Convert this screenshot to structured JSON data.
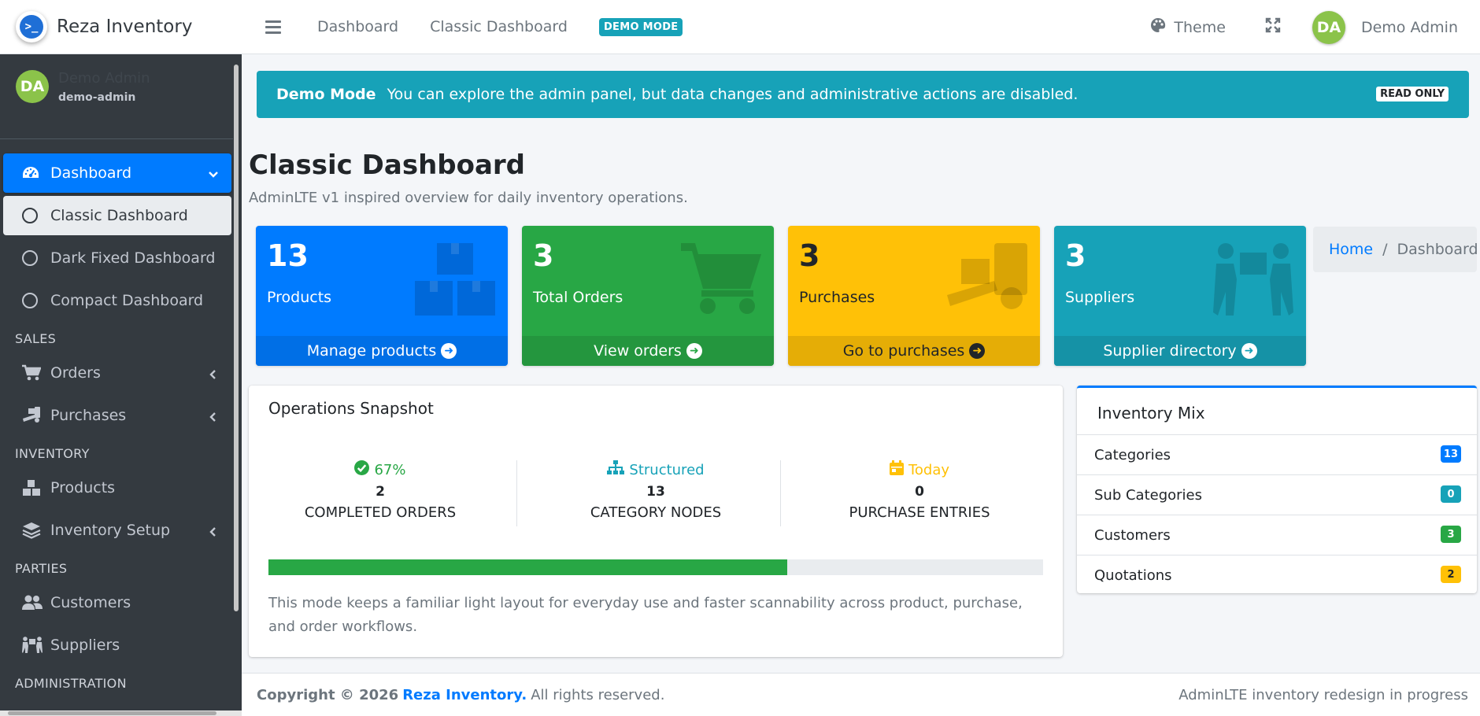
{
  "brand": {
    "name": "Reza Inventory",
    "logo_glyph": ">_"
  },
  "sidebar": {
    "user": {
      "initials": "DA",
      "name": "Demo Admin",
      "handle": "demo-admin"
    },
    "items": [
      {
        "label": "Dashboard"
      },
      {
        "label": "Classic Dashboard"
      },
      {
        "label": "Dark Fixed Dashboard"
      },
      {
        "label": "Compact Dashboard"
      }
    ],
    "sales_header": "SALES",
    "sales": [
      {
        "label": "Orders"
      },
      {
        "label": "Purchases"
      }
    ],
    "inventory_header": "INVENTORY",
    "inventory": [
      {
        "label": "Products"
      },
      {
        "label": "Inventory Setup"
      }
    ],
    "parties_header": "PARTIES",
    "parties": [
      {
        "label": "Customers"
      },
      {
        "label": "Suppliers"
      }
    ],
    "admin_header": "ADMINISTRATION"
  },
  "topbar": {
    "links": [
      "Dashboard",
      "Classic Dashboard"
    ],
    "badge": "DEMO MODE",
    "theme": "Theme",
    "user_initials": "DA",
    "user_name": "Demo Admin"
  },
  "alert": {
    "title": "Demo Mode",
    "message": "You can explore the admin panel, but data changes and administrative actions are disabled.",
    "badge": "READ ONLY"
  },
  "page": {
    "title": "Classic Dashboard",
    "subtitle": "AdminLTE v1 inspired overview for daily inventory operations."
  },
  "breadcrumb": {
    "home": "Home",
    "sep": "/",
    "current": "Dashboard"
  },
  "boxes": [
    {
      "value": "13",
      "label": "Products",
      "link": "Manage products",
      "color": "#007bff",
      "footer_color": "#006fe6"
    },
    {
      "value": "3",
      "label": "Total Orders",
      "link": "View orders",
      "color": "#28a745",
      "footer_color": "#24963e"
    },
    {
      "value": "3",
      "label": "Purchases",
      "link": "Go to purchases",
      "color": "#ffc107",
      "footer_color": "#e5ad06"
    },
    {
      "value": "3",
      "label": "Suppliers",
      "link": "Supplier directory",
      "color": "#17a2b8",
      "footer_color": "#1592a6"
    }
  ],
  "snapshot": {
    "title": "Operations Snapshot",
    "stats": [
      {
        "top": "67%",
        "value": "2",
        "label": "COMPLETED ORDERS",
        "color": "#28a745"
      },
      {
        "top": "Structured",
        "value": "13",
        "label": "CATEGORY NODES",
        "color": "#17a2b8"
      },
      {
        "top": "Today",
        "value": "0",
        "label": "PURCHASE ENTRIES",
        "color": "#ffc107"
      }
    ],
    "progress_percent": 67,
    "text": "This mode keeps a familiar light layout for everyday use and faster scannability across product, purchase, and order workflows."
  },
  "mix": {
    "title": "Inventory Mix",
    "rows": [
      {
        "label": "Categories",
        "count": "13",
        "color": "#007bff"
      },
      {
        "label": "Sub Categories",
        "count": "0",
        "color": "#17a2b8"
      },
      {
        "label": "Customers",
        "count": "3",
        "color": "#28a745"
      },
      {
        "label": "Quotations",
        "count": "2",
        "color": "#ffc107"
      }
    ]
  },
  "footer": {
    "copyright": "Copyright © 2026",
    "brand": "Reza Inventory.",
    "rights": "All rights reserved.",
    "right_text": "AdminLTE inventory redesign in progress"
  }
}
